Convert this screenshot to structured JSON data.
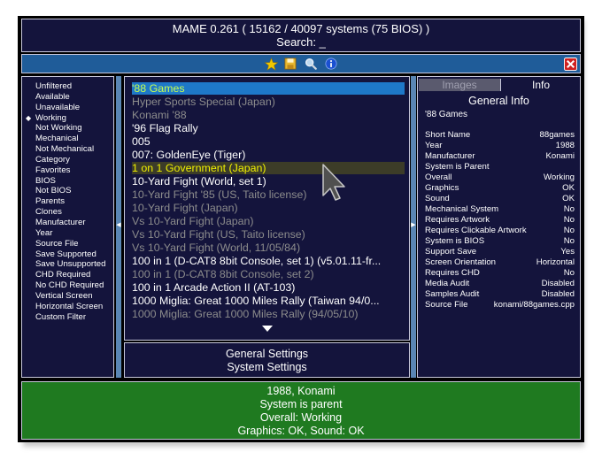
{
  "header": {
    "title": "MAME 0.261 ( 15162 / 40097 systems (75 BIOS) )",
    "search_label": "Search: _"
  },
  "toolbar": {
    "icons": [
      "star-icon",
      "save-icon",
      "search-icon",
      "info-icon",
      "close-icon"
    ],
    "colors": {
      "bar": "#1f5c99",
      "star": "#f0c800",
      "close": "#d02020"
    }
  },
  "filters": {
    "items": [
      {
        "label": "Unfiltered",
        "active": false
      },
      {
        "label": "Available",
        "active": false
      },
      {
        "label": "Unavailable",
        "active": false
      },
      {
        "label": "Working",
        "active": true
      },
      {
        "label": "Not Working",
        "active": false
      },
      {
        "label": "Mechanical",
        "active": false
      },
      {
        "label": "Not Mechanical",
        "active": false
      },
      {
        "label": "Category",
        "active": false
      },
      {
        "label": "Favorites",
        "active": false
      },
      {
        "label": "BIOS",
        "active": false
      },
      {
        "label": "Not BIOS",
        "active": false
      },
      {
        "label": "Parents",
        "active": false
      },
      {
        "label": "Clones",
        "active": false
      },
      {
        "label": "Manufacturer",
        "active": false
      },
      {
        "label": "Year",
        "active": false
      },
      {
        "label": "Source File",
        "active": false
      },
      {
        "label": "Save Supported",
        "active": false
      },
      {
        "label": "Save Unsupported",
        "active": false
      },
      {
        "label": "CHD Required",
        "active": false
      },
      {
        "label": "No CHD Required",
        "active": false
      },
      {
        "label": "Vertical Screen",
        "active": false
      },
      {
        "label": "Horizontal Screen",
        "active": false
      },
      {
        "label": "Custom Filter",
        "active": false
      }
    ]
  },
  "gamelist": {
    "items": [
      {
        "label": "'88 Games",
        "state": "selected"
      },
      {
        "label": "Hyper Sports Special (Japan)",
        "state": "clone"
      },
      {
        "label": "Konami '88",
        "state": "clone"
      },
      {
        "label": "'96 Flag Rally",
        "state": "normal"
      },
      {
        "label": "005",
        "state": "normal"
      },
      {
        "label": "007: GoldenEye (Tiger)",
        "state": "normal"
      },
      {
        "label": "1 on 1 Government (Japan)",
        "state": "hover"
      },
      {
        "label": "10-Yard Fight (World, set 1)",
        "state": "normal"
      },
      {
        "label": "10-Yard Fight '85 (US, Taito license)",
        "state": "clone"
      },
      {
        "label": "10-Yard Fight (Japan)",
        "state": "clone"
      },
      {
        "label": "Vs 10-Yard Fight (Japan)",
        "state": "clone"
      },
      {
        "label": "Vs 10-Yard Fight (US, Taito license)",
        "state": "clone"
      },
      {
        "label": "Vs 10-Yard Fight (World, 11/05/84)",
        "state": "clone"
      },
      {
        "label": "100 in 1 (D-CAT8 8bit Console, set 1) (v5.01.11-fr...",
        "state": "normal"
      },
      {
        "label": "100 in 1 (D-CAT8 8bit Console, set 2)",
        "state": "clone"
      },
      {
        "label": "100 in 1 Arcade Action II (AT-103)",
        "state": "normal"
      },
      {
        "label": "1000 Miglia: Great 1000 Miles Rally (Taiwan 94/0...",
        "state": "normal"
      },
      {
        "label": "1000 Miglia: Great 1000 Miles Rally (94/05/10)",
        "state": "clone"
      }
    ],
    "colors": {
      "selected_text": "#c8ff50",
      "selected_bg": "#1e78c8",
      "hover_text": "#f0f000",
      "normal": "#ffffff",
      "clone": "#8c8c8c"
    }
  },
  "settings": {
    "general": "General Settings",
    "system": "System Settings"
  },
  "info": {
    "tabs": [
      {
        "label": "Images",
        "active": false
      },
      {
        "label": "Info",
        "active": true
      }
    ],
    "title": "General Info",
    "game": "'88 Games",
    "rows": [
      {
        "key": "Short Name",
        "value": "88games"
      },
      {
        "key": "Year",
        "value": "1988"
      },
      {
        "key": "Manufacturer",
        "value": "Konami"
      },
      {
        "key": "System is Parent",
        "value": ""
      },
      {
        "key": "Overall",
        "value": "Working"
      },
      {
        "key": "Graphics",
        "value": "OK"
      },
      {
        "key": "Sound",
        "value": "OK"
      },
      {
        "key": "Mechanical System",
        "value": "No"
      },
      {
        "key": "Requires Artwork",
        "value": "No"
      },
      {
        "key": "Requires Clickable Artwork",
        "value": "No"
      },
      {
        "key": "System is BIOS",
        "value": "No"
      },
      {
        "key": "Support Save",
        "value": "Yes"
      },
      {
        "key": "Screen Orientation",
        "value": "Horizontal"
      },
      {
        "key": "Requires CHD",
        "value": "No"
      },
      {
        "key": "Media Audit",
        "value": "Disabled"
      },
      {
        "key": "Samples Audit",
        "value": "Disabled"
      },
      {
        "key": "Source File",
        "value": "konami/88games.cpp"
      }
    ]
  },
  "status": {
    "lines": [
      "1988, Konami",
      "System is parent",
      "Overall: Working",
      "Graphics: OK, Sound: OK"
    ],
    "color": "#1f7a20"
  }
}
